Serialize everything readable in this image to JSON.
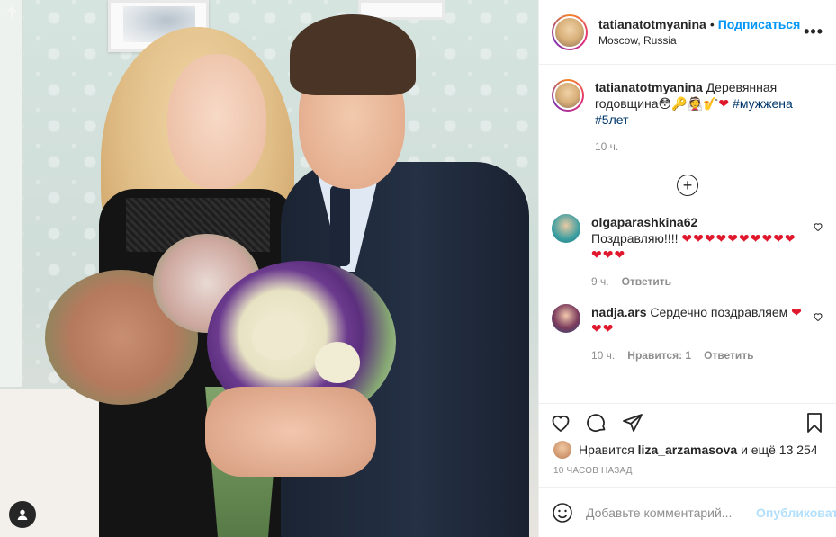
{
  "photo": {
    "alt": "Пост пользователя tatianatotmyanina"
  },
  "header": {
    "username": "tatianatotmyanina",
    "separator": "•",
    "follow_label": "Подписаться",
    "location": "Moscow, Russia",
    "more_label": "•••"
  },
  "caption": {
    "username": "tatianatotmyanina",
    "text": "Деревянная годовщина",
    "emojis": "😳🔑👰🎷",
    "heart": "❤",
    "hashtags": [
      "#мужжена",
      "#5лет"
    ],
    "time": "10 ч."
  },
  "load_more_label": "+",
  "comments": [
    {
      "username": "olgaparashkina62",
      "text": "Поздравляю!!!!",
      "hearts": "❤❤❤❤❤❤❤❤❤❤❤❤❤",
      "time": "9 ч.",
      "likes": "",
      "reply": "Ответить"
    },
    {
      "username": "nadja.ars",
      "text": "Сердечно поздравляем",
      "hearts": "❤❤❤",
      "time": "10 ч.",
      "likes": "Нравится: 1",
      "reply": "Ответить"
    }
  ],
  "likes": {
    "prefix": "Нравится",
    "user": "liza_arzamasova",
    "suffix": "и ещё 13 254"
  },
  "post_time": "10 часов назад",
  "add_comment": {
    "placeholder": "Добавьте комментарий...",
    "publish": "Опубликовать"
  },
  "colors": {
    "accent": "#0095f6",
    "heart": "#e0182d",
    "muted": "#8e8e8e"
  }
}
